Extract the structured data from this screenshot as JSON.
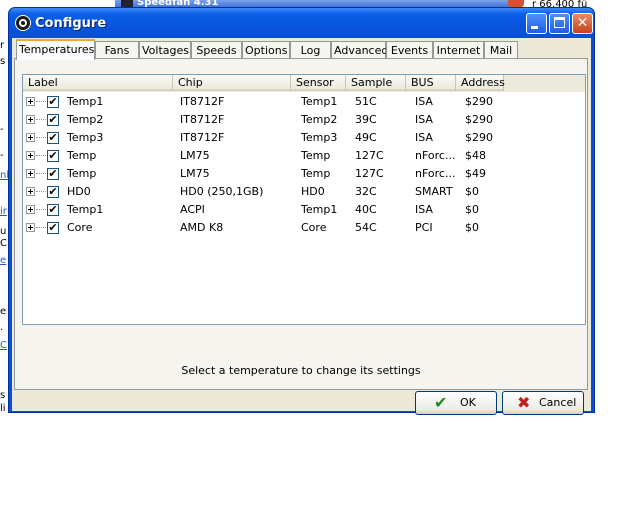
{
  "window": {
    "title": "Configure"
  },
  "background": {
    "titlebar_text": "Speedfan 4.31",
    "right_text": "r 66.400 fü",
    "fragments": [
      "r",
      "s",
      "-",
      "-",
      "nl",
      "ir",
      "u",
      "C",
      "e",
      "e",
      ".",
      "C",
      "s",
      "li"
    ]
  },
  "tabs": [
    {
      "label": "Temperatures",
      "active": true
    },
    {
      "label": "Fans"
    },
    {
      "label": "Voltages"
    },
    {
      "label": "Speeds"
    },
    {
      "label": "Options"
    },
    {
      "label": "Log"
    },
    {
      "label": "Advanced"
    },
    {
      "label": "Events"
    },
    {
      "label": "Internet"
    },
    {
      "label": "Mail"
    }
  ],
  "columns": [
    "Label",
    "Chip",
    "Sensor",
    "Sample",
    "BUS",
    "Address"
  ],
  "rows": [
    {
      "label": "Temp1",
      "chip": "IT8712F",
      "sensor": "Temp1",
      "sample": "51C",
      "bus": "ISA",
      "address": "$290",
      "checked": true
    },
    {
      "label": "Temp2",
      "chip": "IT8712F",
      "sensor": "Temp2",
      "sample": "39C",
      "bus": "ISA",
      "address": "$290",
      "checked": true
    },
    {
      "label": "Temp3",
      "chip": "IT8712F",
      "sensor": "Temp3",
      "sample": "49C",
      "bus": "ISA",
      "address": "$290",
      "checked": true
    },
    {
      "label": "Temp",
      "chip": "LM75",
      "sensor": "Temp",
      "sample": "127C",
      "bus": "nForc...",
      "address": "$48",
      "checked": true
    },
    {
      "label": "Temp",
      "chip": "LM75",
      "sensor": "Temp",
      "sample": "127C",
      "bus": "nForc...",
      "address": "$49",
      "checked": true
    },
    {
      "label": "HD0",
      "chip": "HD0 (250,1GB)",
      "sensor": "HD0",
      "sample": "32C",
      "bus": "SMART",
      "address": "$0",
      "checked": true
    },
    {
      "label": "Temp1",
      "chip": "ACPI",
      "sensor": "Temp1",
      "sample": "40C",
      "bus": "ISA",
      "address": "$0",
      "checked": true
    },
    {
      "label": "Core",
      "chip": "AMD K8",
      "sensor": "Core",
      "sample": "54C",
      "bus": "PCI",
      "address": "$0",
      "checked": true
    }
  ],
  "hint": "Select a temperature to change its settings",
  "buttons": {
    "ok": "OK",
    "cancel": "Cancel"
  },
  "icons": {
    "ok": "checkmark-icon",
    "cancel": "x-mark-icon",
    "check": "✔"
  },
  "colors": {
    "titlebar": "#0c5fe8",
    "dialog_bg": "#ece9d8",
    "ok_icon": "#1f8a1f",
    "cancel_icon": "#c0201a"
  }
}
